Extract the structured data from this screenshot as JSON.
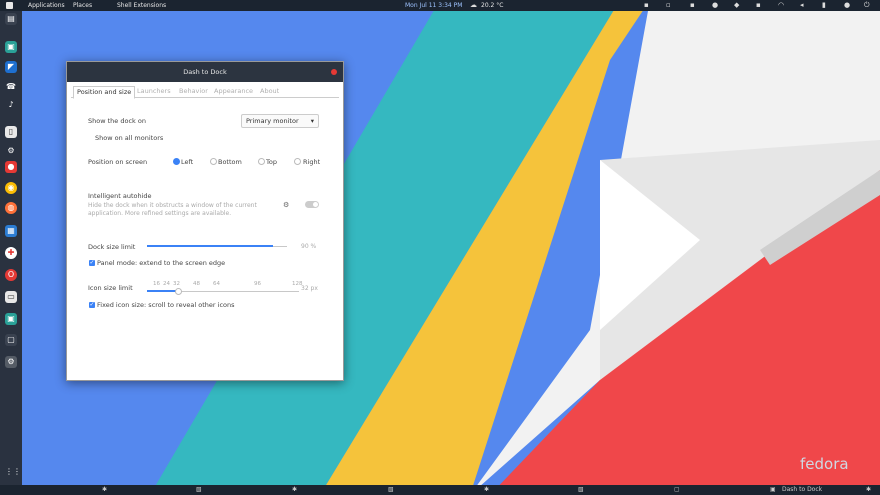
{
  "topbar": {
    "applications": "Applications",
    "places": "Places",
    "shell_extensions": "Shell Extensions",
    "clock": "Mon Jul 11 3:34 PM",
    "weather": "20.2 °C"
  },
  "window": {
    "title": "Dash to Dock",
    "tabs": [
      "Position and size",
      "Launchers",
      "Behavior",
      "Appearance",
      "About"
    ],
    "show_dock_on_label": "Show the dock on",
    "monitor_select_value": "Primary monitor",
    "show_all_monitors_label": "Show on all monitors",
    "position_label": "Position on screen",
    "position_options": [
      "Left",
      "Bottom",
      "Top",
      "Right"
    ],
    "position_selected": "Left",
    "autohide_title": "Intelligent autohide",
    "autohide_desc_line1": "Hide the dock when it obstructs a window of the current",
    "autohide_desc_line2": "application. More refined settings are available.",
    "dock_size_label": "Dock size limit",
    "dock_size_value": "90 %",
    "dock_size_fraction": 0.9,
    "panel_mode_label": "Panel mode: extend to the screen edge",
    "icon_size_label": "Icon size limit",
    "icon_ticks": [
      "16",
      "24",
      "32",
      "48",
      "64",
      "96",
      "128"
    ],
    "icon_size_value": "32 px",
    "fixed_icon_label": "Fixed icon size: scroll to reveal other icons"
  },
  "taskbar": {
    "active_window": "Dash to Dock"
  },
  "branding": "fedora",
  "colors": {
    "accent": "#3b82f6",
    "panel": "#1b2430",
    "dock": "#2a3240"
  }
}
